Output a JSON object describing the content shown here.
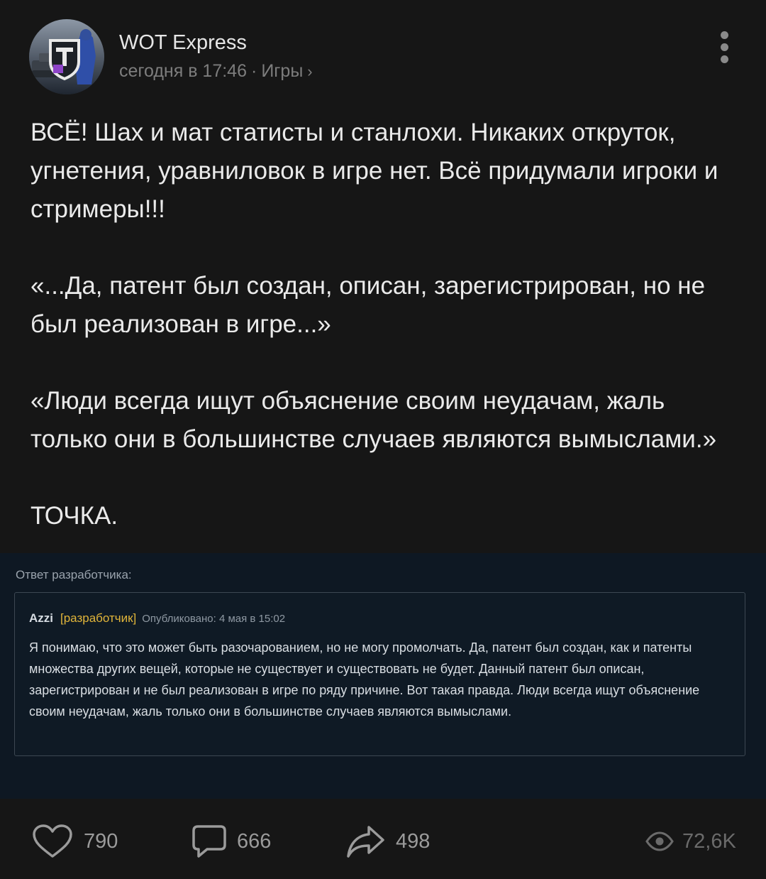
{
  "post": {
    "author": "WOT Express",
    "time": "сегодня в 17:46",
    "separator": "·",
    "category": "Игры",
    "category_chevron": "›",
    "paragraphs": [
      "ВСЁ! Шах и мат статисты и станлохи. Никаких откруток, угнетения, уравниловок в игре нет. Всё придумали игроки и стримеры!!!",
      "«...Да, патент был создан, описан, зарегистрирован, но не был реализован в игре...»",
      "«Люди всегда ищут объяснение своим неудачам, жаль только они в большинстве случаев являются вымыслами.»",
      "ТОЧКА."
    ]
  },
  "embed": {
    "caption": "Ответ разработчика:",
    "quote_author": "Azzi",
    "quote_role": "[разработчик]",
    "quote_date": "Опубликовано: 4 мая в 15:02",
    "quote_text": "Я понимаю, что это может быть разочарованием, но не могу промолчать. Да, патент был создан, как и патенты множества других вещей, которые не существует и существовать не будет. Данный патент был описан, зарегистрирован и не был реализован в игре по ряду причине. Вот такая правда. Люди всегда ищут объяснение своим неудачам, жаль только они в большинстве случаев являются вымыслами."
  },
  "actions": {
    "likes": "790",
    "comments": "666",
    "shares": "498",
    "views": "72,6K"
  },
  "icons": {
    "avatar": "wot-express-avatar",
    "more": "more-vertical-icon",
    "like": "heart-icon",
    "comment": "comment-bubble-icon",
    "share": "share-arrow-icon",
    "views": "eye-icon"
  },
  "colors": {
    "background": "#161616",
    "embed_background": "#0e1823",
    "developer_tag": "#e1b53a",
    "muted_text": "#7d7d7d"
  }
}
